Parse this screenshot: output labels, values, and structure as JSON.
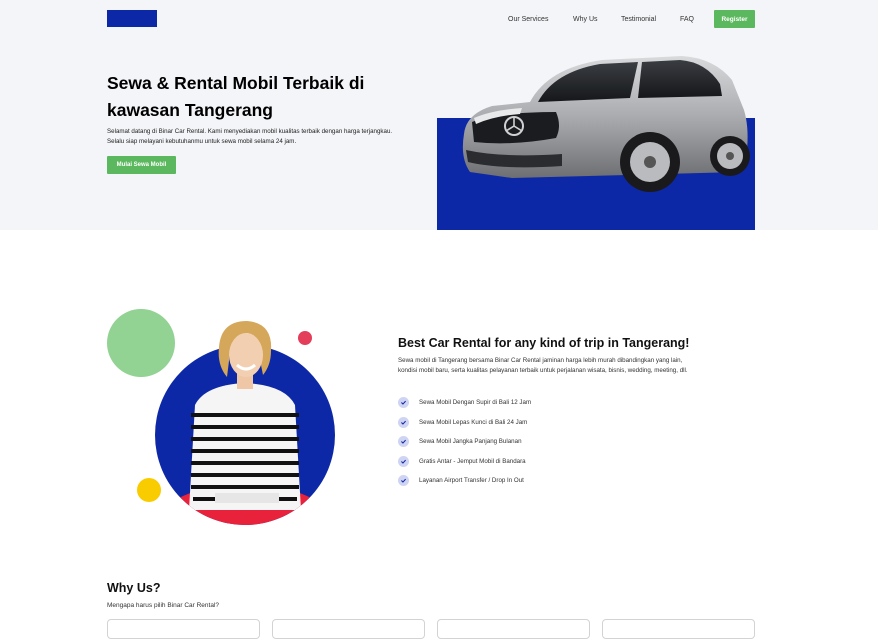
{
  "header": {
    "logo_color": "#0d28a6",
    "nav": [
      "Our Services",
      "Why Us",
      "Testimonial",
      "FAQ"
    ],
    "register_label": "Register"
  },
  "hero": {
    "title": "Sewa & Rental Mobil Terbaik di kawasan Tangerang",
    "description": "Selamat datang di Binar Car Rental. Kami menyediakan mobil kualitas terbaik dengan harga terjangkau. Selalu siap melayani kebutuhanmu untuk sewa mobil selama 24 jam.",
    "cta_label": "Mulai Sewa Mobil",
    "image": "car-image"
  },
  "services": {
    "title": "Best Car Rental for any kind of trip in Tangerang!",
    "description": "Sewa mobil di Tangerang bersama Binar Car Rental jaminan harga lebih murah dibandingkan yang lain, kondisi mobil baru, serta kualitas pelayanan terbaik untuk perjalanan wisata, bisnis, wedding, meeting, dll.",
    "items": [
      "Sewa Mobil Dengan Supir di Bali 12 Jam",
      "Sewa Mobil Lepas Kunci di Bali 24 Jam",
      "Sewa Mobil Jangka Panjang Bulanan",
      "Gratis Antar - Jemput Mobil di Bandara",
      "Layanan Airport Transfer / Drop In Out"
    ],
    "image": "woman-with-laptop-image"
  },
  "why_us": {
    "title": "Why Us?",
    "subtitle": "Mengapa harus pilih Binar Car Rental?"
  },
  "colors": {
    "brand_blue": "#0d28a6",
    "green": "#5cb85f",
    "hero_bg": "#f4f5f8",
    "circle_green": "#92d293",
    "circle_yellow": "#f9cc00",
    "circle_red": "#e43d5a"
  }
}
